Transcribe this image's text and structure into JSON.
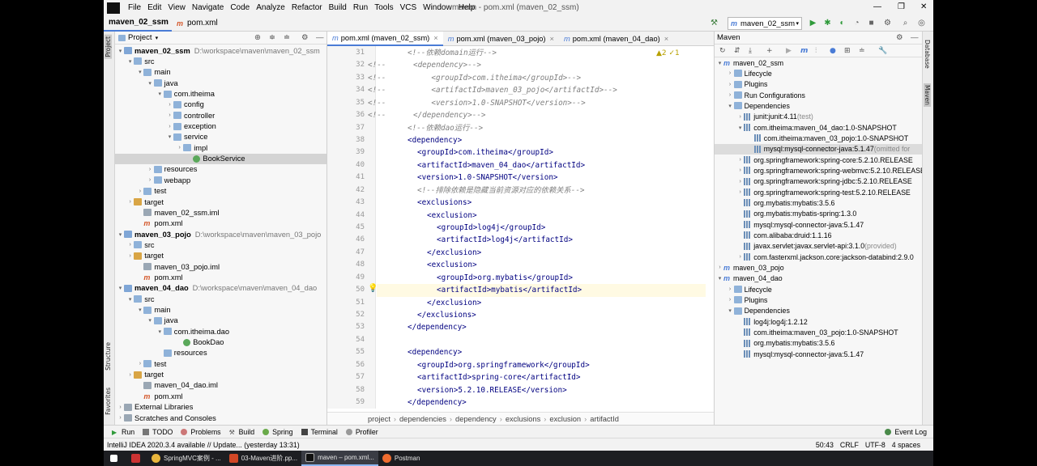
{
  "menu": {
    "items": [
      "File",
      "Edit",
      "View",
      "Navigate",
      "Code",
      "Analyze",
      "Refactor",
      "Build",
      "Run",
      "Tools",
      "VCS",
      "Window",
      "Help"
    ],
    "window_title": "maven - pom.xml (maven_02_ssm)"
  },
  "nav": {
    "crumbs": [
      "maven_02_ssm",
      "pom.xml"
    ],
    "run_config": "maven_02_ssm"
  },
  "side_tabs": {
    "project": "Project",
    "structure": "Structure",
    "favorites": "Favorites",
    "database": "Database",
    "maven": "Maven"
  },
  "project": {
    "title": "Project",
    "rows": [
      {
        "text": "maven_02_ssm",
        "path": "D:\\workspace\\maven\\maven_02_ssm",
        "indent": 0,
        "arrow": "▾",
        "icon": "modf",
        "bold": true
      },
      {
        "text": "src",
        "indent": 1,
        "arrow": "▾",
        "icon": "fold"
      },
      {
        "text": "main",
        "indent": 2,
        "arrow": "▾",
        "icon": "fold"
      },
      {
        "text": "java",
        "indent": 3,
        "arrow": "▾",
        "icon": "fold"
      },
      {
        "text": "com.itheima",
        "indent": 4,
        "arrow": "▾",
        "icon": "fold"
      },
      {
        "text": "config",
        "indent": 5,
        "arrow": "›",
        "icon": "fold"
      },
      {
        "text": "controller",
        "indent": 5,
        "arrow": "›",
        "icon": "fold"
      },
      {
        "text": "exception",
        "indent": 5,
        "arrow": "›",
        "icon": "fold"
      },
      {
        "text": "service",
        "indent": 5,
        "arrow": "▾",
        "icon": "fold"
      },
      {
        "text": "impl",
        "indent": 6,
        "arrow": "›",
        "icon": "fold"
      },
      {
        "text": "BookService",
        "indent": 7,
        "arrow": "",
        "icon": "cls",
        "sel": true
      },
      {
        "text": "resources",
        "indent": 3,
        "arrow": "›",
        "icon": "fold"
      },
      {
        "text": "webapp",
        "indent": 3,
        "arrow": "›",
        "icon": "fold"
      },
      {
        "text": "test",
        "indent": 2,
        "arrow": "›",
        "icon": "fold"
      },
      {
        "text": "target",
        "indent": 1,
        "arrow": "›",
        "icon": "foldo"
      },
      {
        "text": "maven_02_ssm.iml",
        "indent": 2,
        "arrow": "",
        "icon": "iml"
      },
      {
        "text": "pom.xml",
        "indent": 2,
        "arrow": "",
        "icon": "xml"
      },
      {
        "text": "maven_03_pojo",
        "path": "D:\\workspace\\maven\\maven_03_pojo",
        "indent": 0,
        "arrow": "▾",
        "icon": "modf",
        "bold": true
      },
      {
        "text": "src",
        "indent": 1,
        "arrow": "›",
        "icon": "fold"
      },
      {
        "text": "target",
        "indent": 1,
        "arrow": "›",
        "icon": "foldo"
      },
      {
        "text": "maven_03_pojo.iml",
        "indent": 2,
        "arrow": "",
        "icon": "iml"
      },
      {
        "text": "pom.xml",
        "indent": 2,
        "arrow": "",
        "icon": "xml"
      },
      {
        "text": "maven_04_dao",
        "path": "D:\\workspace\\maven\\maven_04_dao",
        "indent": 0,
        "arrow": "▾",
        "icon": "modf",
        "bold": true
      },
      {
        "text": "src",
        "indent": 1,
        "arrow": "▾",
        "icon": "fold"
      },
      {
        "text": "main",
        "indent": 2,
        "arrow": "▾",
        "icon": "fold"
      },
      {
        "text": "java",
        "indent": 3,
        "arrow": "▾",
        "icon": "fold"
      },
      {
        "text": "com.itheima.dao",
        "indent": 4,
        "arrow": "▾",
        "icon": "fold"
      },
      {
        "text": "BookDao",
        "indent": 6,
        "arrow": "",
        "icon": "cls"
      },
      {
        "text": "resources",
        "indent": 4,
        "arrow": "",
        "icon": "fold"
      },
      {
        "text": "test",
        "indent": 2,
        "arrow": "›",
        "icon": "fold"
      },
      {
        "text": "target",
        "indent": 1,
        "arrow": "›",
        "icon": "foldo"
      },
      {
        "text": "maven_04_dao.iml",
        "indent": 2,
        "arrow": "",
        "icon": "iml"
      },
      {
        "text": "pom.xml",
        "indent": 2,
        "arrow": "",
        "icon": "xml"
      },
      {
        "text": "External Libraries",
        "indent": 0,
        "arrow": "›",
        "icon": "iml"
      },
      {
        "text": "Scratches and Consoles",
        "indent": 0,
        "arrow": "›",
        "icon": "iml"
      }
    ]
  },
  "editor": {
    "tabs": [
      "pom.xml (maven_02_ssm)",
      "pom.xml (maven_03_pojo)",
      "pom.xml (maven_04_dao)"
    ],
    "warnings": "▲2  ✓1",
    "lines": [
      {
        "n": "31",
        "indent": 2,
        "kind": "cmt",
        "text": "<!--依赖domain运行-->"
      },
      {
        "n": "32",
        "indent": 0,
        "kind": "cmt",
        "text": "<!--      <dependency>-->"
      },
      {
        "n": "33",
        "indent": 0,
        "kind": "cmt",
        "text": "<!--          <groupId>com.itheima</groupId>-->"
      },
      {
        "n": "34",
        "indent": 0,
        "kind": "cmt",
        "text": "<!--          <artifactId>maven_03_pojo</artifactId>-->"
      },
      {
        "n": "35",
        "indent": 0,
        "kind": "cmt",
        "text": "<!--          <version>1.0-SNAPSHOT</version>-->"
      },
      {
        "n": "36",
        "indent": 0,
        "kind": "cmt",
        "text": "<!--      </dependency>-->"
      },
      {
        "n": "37",
        "indent": 2,
        "kind": "cmt",
        "text": "<!--依赖dao运行-->"
      },
      {
        "n": "38",
        "indent": 2,
        "kind": "tag",
        "text": "<dependency>"
      },
      {
        "n": "39",
        "indent": 3,
        "kind": "tag",
        "text": "<groupId>com.itheima</groupId>"
      },
      {
        "n": "40",
        "indent": 3,
        "kind": "tag",
        "text": "<artifactId>maven_04_dao</artifactId>"
      },
      {
        "n": "41",
        "indent": 3,
        "kind": "tag",
        "text": "<version>1.0-SNAPSHOT</version>"
      },
      {
        "n": "42",
        "indent": 3,
        "kind": "cmt",
        "text": "<!--排除依赖是隐藏当前资源对应的依赖关系-->"
      },
      {
        "n": "43",
        "indent": 3,
        "kind": "tag",
        "text": "<exclusions>"
      },
      {
        "n": "44",
        "indent": 4,
        "kind": "tag",
        "text": "<exclusion>"
      },
      {
        "n": "45",
        "indent": 5,
        "kind": "tag",
        "text": "<groupId>log4j</groupId>"
      },
      {
        "n": "46",
        "indent": 5,
        "kind": "tag",
        "text": "<artifactId>log4j</artifactId>"
      },
      {
        "n": "47",
        "indent": 4,
        "kind": "tag",
        "text": "</exclusion>"
      },
      {
        "n": "48",
        "indent": 4,
        "kind": "tag",
        "text": "<exclusion>"
      },
      {
        "n": "49",
        "indent": 5,
        "kind": "tag",
        "text": "<groupId>org.mybatis</groupId>"
      },
      {
        "n": "50",
        "indent": 5,
        "kind": "tag",
        "text": "<artifactId>mybatis</artifactId>",
        "hl": true
      },
      {
        "n": "51",
        "indent": 4,
        "kind": "tag",
        "text": "</exclusion>"
      },
      {
        "n": "52",
        "indent": 3,
        "kind": "tag",
        "text": "</exclusions>"
      },
      {
        "n": "53",
        "indent": 2,
        "kind": "tag",
        "text": "</dependency>"
      },
      {
        "n": "54",
        "indent": 0,
        "kind": "tag",
        "text": ""
      },
      {
        "n": "55",
        "indent": 2,
        "kind": "tag",
        "text": "<dependency>"
      },
      {
        "n": "56",
        "indent": 3,
        "kind": "tag",
        "text": "<groupId>org.springframework</groupId>"
      },
      {
        "n": "57",
        "indent": 3,
        "kind": "tag",
        "text": "<artifactId>spring-core</artifactId>"
      },
      {
        "n": "58",
        "indent": 3,
        "kind": "tag",
        "text": "<version>5.2.10.RELEASE</version>"
      },
      {
        "n": "59",
        "indent": 2,
        "kind": "tag",
        "text": "</dependency>"
      }
    ],
    "breadcrumbs": [
      "project",
      "dependencies",
      "dependency",
      "exclusions",
      "exclusion",
      "artifactId"
    ]
  },
  "maven": {
    "title": "Maven",
    "rows": [
      {
        "text": "maven_02_ssm",
        "indent": 0,
        "arrow": "▾",
        "icon": "mav"
      },
      {
        "text": "Lifecycle",
        "indent": 1,
        "arrow": "›",
        "icon": "fold"
      },
      {
        "text": "Plugins",
        "indent": 1,
        "arrow": "›",
        "icon": "fold"
      },
      {
        "text": "Run Configurations",
        "indent": 1,
        "arrow": "›",
        "icon": "fold"
      },
      {
        "text": "Dependencies",
        "indent": 1,
        "arrow": "▾",
        "icon": "fold"
      },
      {
        "text": "junit:junit:4.11",
        "extra": " (test)",
        "indent": 2,
        "arrow": "›",
        "icon": "dep"
      },
      {
        "text": "com.itheima:maven_04_dao:1.0-SNAPSHOT",
        "indent": 2,
        "arrow": "▾",
        "icon": "dep"
      },
      {
        "text": "com.itheima:maven_03_pojo:1.0-SNAPSHOT",
        "indent": 3,
        "arrow": "",
        "icon": "dep"
      },
      {
        "text": "mysql:mysql-connector-java:5.1.47",
        "extra": " (omitted for",
        "indent": 3,
        "arrow": "",
        "icon": "dep",
        "sel": true
      },
      {
        "text": "org.springframework:spring-core:5.2.10.RELEASE",
        "indent": 2,
        "arrow": "›",
        "icon": "dep"
      },
      {
        "text": "org.springframework:spring-webmvc:5.2.10.RELEASE",
        "indent": 2,
        "arrow": "›",
        "icon": "dep"
      },
      {
        "text": "org.springframework:spring-jdbc:5.2.10.RELEASE",
        "indent": 2,
        "arrow": "›",
        "icon": "dep"
      },
      {
        "text": "org.springframework:spring-test:5.2.10.RELEASE",
        "indent": 2,
        "arrow": "›",
        "icon": "dep"
      },
      {
        "text": "org.mybatis:mybatis:3.5.6",
        "indent": 2,
        "arrow": "",
        "icon": "dep"
      },
      {
        "text": "org.mybatis:mybatis-spring:1.3.0",
        "indent": 2,
        "arrow": "",
        "icon": "dep"
      },
      {
        "text": "mysql:mysql-connector-java:5.1.47",
        "indent": 2,
        "arrow": "",
        "icon": "dep"
      },
      {
        "text": "com.alibaba:druid:1.1.16",
        "indent": 2,
        "arrow": "",
        "icon": "dep"
      },
      {
        "text": "javax.servlet:javax.servlet-api:3.1.0",
        "extra": " (provided)",
        "indent": 2,
        "arrow": "",
        "icon": "dep"
      },
      {
        "text": "com.fasterxml.jackson.core:jackson-databind:2.9.0",
        "indent": 2,
        "arrow": "›",
        "icon": "dep"
      },
      {
        "text": "maven_03_pojo",
        "indent": 0,
        "arrow": "›",
        "icon": "mav"
      },
      {
        "text": "maven_04_dao",
        "indent": 0,
        "arrow": "▾",
        "icon": "mav"
      },
      {
        "text": "Lifecycle",
        "indent": 1,
        "arrow": "›",
        "icon": "fold"
      },
      {
        "text": "Plugins",
        "indent": 1,
        "arrow": "›",
        "icon": "fold"
      },
      {
        "text": "Dependencies",
        "indent": 1,
        "arrow": "▾",
        "icon": "fold"
      },
      {
        "text": "log4j:log4j:1.2.12",
        "indent": 2,
        "arrow": "",
        "icon": "dep"
      },
      {
        "text": "com.itheima:maven_03_pojo:1.0-SNAPSHOT",
        "indent": 2,
        "arrow": "",
        "icon": "dep"
      },
      {
        "text": "org.mybatis:mybatis:3.5.6",
        "indent": 2,
        "arrow": "",
        "icon": "dep"
      },
      {
        "text": "mysql:mysql-connector-java:5.1.47",
        "indent": 2,
        "arrow": "",
        "icon": "dep"
      }
    ]
  },
  "bottom": {
    "tools": [
      "Run",
      "TODO",
      "Problems",
      "Build",
      "Spring",
      "Terminal",
      "Profiler"
    ],
    "event_log": "Event Log",
    "status": "IntelliJ IDEA 2020.3.4 available // Update... (yesterday 13:31)",
    "position": "50:43",
    "line_sep": "CRLF",
    "encoding": "UTF-8",
    "indent": "4 spaces"
  },
  "taskbar": {
    "items": [
      "SpringMVC案例 - ...",
      "03-Maven进阶.pp...",
      "maven – pom.xml...",
      "Postman"
    ]
  },
  "colors": {
    "accent": "#4a7cd6",
    "tag": "#000080",
    "comment": "#808080",
    "selection": "#d4d4d4"
  }
}
